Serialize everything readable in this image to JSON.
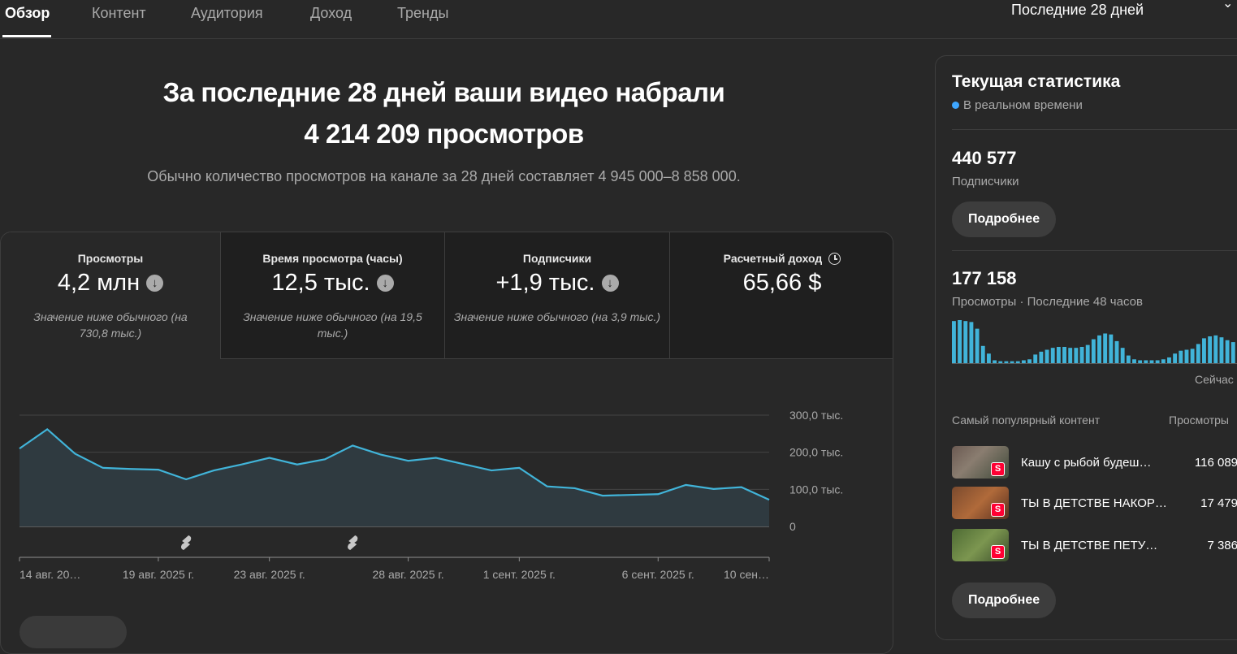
{
  "tabs": [
    "Обзор",
    "Контент",
    "Аудитория",
    "Доход",
    "Тренды"
  ],
  "period_label": "Последние 28 дней",
  "colors": {
    "accent": "#3ea6ff",
    "line": "#41b4d9",
    "background": "#282828"
  },
  "headline": {
    "line1": "За последние 28 дней ваши видео набрали",
    "line2": "4 214 209 просмотров"
  },
  "subline": "Обычно количество просмотров на канале за 28 дней составляет 4 945 000–8 858 000.",
  "metrics": [
    {
      "label": "Просмотры",
      "value": "4,2 млн",
      "note": "Значение ниже обычного (на 730,8 тыс.)",
      "trend_icon": "arrow-down-icon"
    },
    {
      "label": "Время просмотра (часы)",
      "value": "12,5 тыс.",
      "note": "Значение ниже обычного (на 19,5 тыс.)",
      "trend_icon": "arrow-down-icon"
    },
    {
      "label": "Подписчики",
      "value": "+1,9 тыс.",
      "note": "Значение ниже обычного (на 3,9 тыс.)",
      "trend_icon": "arrow-down-icon"
    },
    {
      "label": "Расчетный доход",
      "value": "65,66 $",
      "note": "",
      "info_icon": "clock-icon"
    }
  ],
  "chart_data": {
    "type": "area",
    "x": [
      "14 авг.",
      "15 авг.",
      "16 авг.",
      "17 авг.",
      "18 авг.",
      "19 авг.",
      "20 авг.",
      "21 авг.",
      "22 авг.",
      "23 авг.",
      "24 авг.",
      "25 авг.",
      "26 авг.",
      "27 авг.",
      "28 авг.",
      "29 авг.",
      "30 авг.",
      "31 авг.",
      "1 сент.",
      "2 сент.",
      "3 сент.",
      "4 сент.",
      "5 сент.",
      "6 сент.",
      "7 сент.",
      "8 сент.",
      "9 сент.",
      "10 сент."
    ],
    "values": [
      210000,
      262000,
      196000,
      158000,
      155000,
      153000,
      127000,
      151000,
      167000,
      185000,
      167000,
      181000,
      218000,
      194000,
      177000,
      185000,
      168000,
      151000,
      158000,
      108000,
      103000,
      83000,
      85000,
      87000,
      112000,
      101000,
      106000,
      72000
    ],
    "ylim": [
      0,
      300000
    ],
    "y_tick_labels": [
      "0",
      "100,0 тыс.",
      "200,0 тыс.",
      "300,0 тыс."
    ],
    "x_tick_labels": [
      "14 авг. 20…",
      "19 авг. 2025 г.",
      "23 авг. 2025 г.",
      "28 авг. 2025 г.",
      "1 сент. 2025 г.",
      "6 сент. 2025 г.",
      "10 сен…"
    ],
    "x_tick_indices": [
      0,
      5,
      9,
      14,
      18,
      23,
      27
    ],
    "marker_icon": "shorts-icon",
    "marker_indices": [
      6,
      12
    ],
    "grid": true,
    "legend": "none"
  },
  "realtime": {
    "title": "Текущая статистика",
    "live_label": "В реальном времени",
    "subscribers_value": "440 577",
    "subscribers_label": "Подписчики",
    "more_label": "Подробнее",
    "views_value": "177 158",
    "views_label": "Просмотры · Последние 48 часов",
    "now_label": "Сейчас",
    "bars": [
      44,
      45,
      44,
      43,
      36,
      18,
      10,
      3,
      2,
      2,
      2,
      2,
      3,
      4,
      9,
      12,
      14,
      16,
      17,
      17,
      16,
      16,
      17,
      19,
      25,
      29,
      31,
      30,
      23,
      16,
      8,
      4,
      3,
      3,
      3,
      3,
      4,
      6,
      10,
      13,
      14,
      15,
      20,
      26,
      28,
      29,
      27,
      24,
      22
    ],
    "top_content_header": "Самый популярный контент",
    "top_views_header": "Просмотры",
    "top_content": [
      {
        "title": "Кашу с рыбой будеш…",
        "views": "116 089"
      },
      {
        "title": "ТЫ В ДЕТСТВЕ НАКОР…",
        "views": "17 479"
      },
      {
        "title": "ТЫ В ДЕТСТВЕ ПЕТУШО…",
        "views": "7 386"
      }
    ],
    "more_label_2": "Подробнее"
  }
}
